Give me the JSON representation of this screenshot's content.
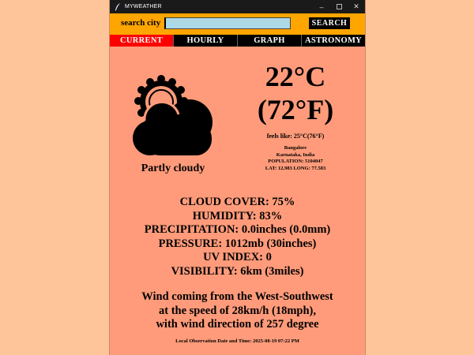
{
  "window": {
    "title": "MYWEATHER",
    "icons": [
      "feather-icon",
      "minimize-icon",
      "maximize-icon",
      "close-icon"
    ]
  },
  "search": {
    "label": "search city",
    "value": "",
    "button_label": "SEARCH"
  },
  "tabs": [
    {
      "label": "CURRENT",
      "active": true
    },
    {
      "label": "HOURLY",
      "active": false
    },
    {
      "label": "GRAPH",
      "active": false
    },
    {
      "label": "ASTRONOMY",
      "active": false
    }
  ],
  "current": {
    "icon": "partly-cloudy-icon",
    "condition": "Partly cloudy",
    "temp_c": "22°C",
    "temp_f": "(72°F)",
    "feels_like": "feels like: 25°C(76°F)",
    "location": {
      "city": "Bangalore",
      "region": "Karnataka, India",
      "population": "POPULATION: 5104047",
      "coords": "LAT: 12.983 LONG: 77.583"
    },
    "stats": [
      "CLOUD COVER: 75%",
      "HUMIDITY: 83%",
      "PRECIPITATION: 0.0inches (0.0mm)",
      "PRESSURE: 1012mb (30inches)",
      "UV INDEX: 0",
      "VISIBILITY: 6km (3miles)"
    ],
    "wind": [
      "Wind coming from the West-Southwest",
      "at the speed of 28km/h (18mph),",
      "with wind direction of 257 degree"
    ],
    "observation": "Local Observation Date and Time: 2025-08-19 07:22 PM"
  },
  "colors": {
    "background": "#ffc59a",
    "content": "#ff9b7a",
    "search_bar": "#ffa500",
    "input": "#add8e6",
    "active_tab": "#ff0000",
    "tab_bar": "#000000"
  }
}
